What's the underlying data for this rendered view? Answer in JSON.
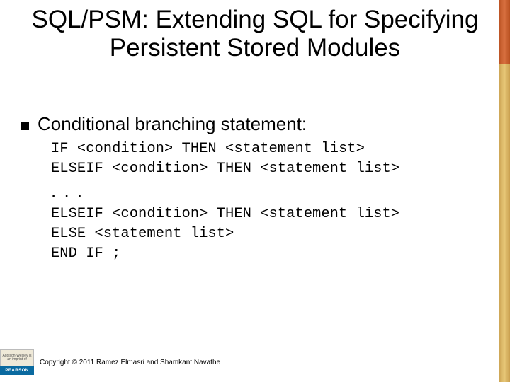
{
  "title": "SQL/PSM: Extending SQL for Specifying Persistent Stored Modules",
  "bullet": "Conditional branching statement:",
  "code1": "IF <condition> THEN <statement list>\nELSEIF <condition> THEN <statement list>",
  "dots": ". . .",
  "code2": "ELSEIF <condition> THEN <statement list>\nELSE <statement list>\nEND IF ;",
  "logo": {
    "top": "Addison-Wesley is an imprint of",
    "bottom": "PEARSON"
  },
  "copyright": "Copyright © 2011 Ramez Elmasri and Shamkant Navathe"
}
